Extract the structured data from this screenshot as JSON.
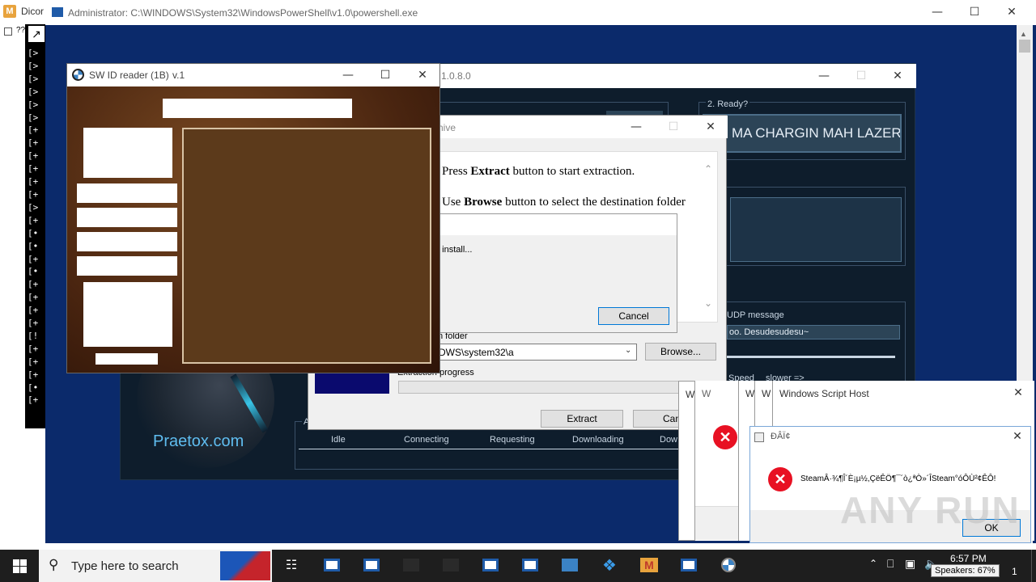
{
  "discord_win": {
    "title": "Dicor",
    "toolbar_text": "??"
  },
  "powershell": {
    "title": "Administrator: C:\\WINDOWS\\System32\\WindowsPowerShell\\v1.0\\powershell.exe",
    "lines": [
      "[>",
      "[>",
      "[>",
      "[>",
      "[>",
      "[>",
      "[+",
      "[+",
      "[+",
      "[+",
      "[+",
      "[+",
      "[>",
      "[+",
      "[•",
      "[•",
      "[+",
      "[•",
      "[+",
      "[+",
      "[+",
      "[+",
      "[!",
      "[+",
      "[+",
      "[+",
      "[•",
      "[+"
    ]
  },
  "loic": {
    "title": "1.0.8.0",
    "ready_label": "2. Ready?",
    "fire_button": "MA CHARGIN MAH LAZER",
    "udp_label": "UDP message",
    "udp_value": "oo. Desudesudesu~",
    "speed_label": "Speed",
    "speed_value": "slower =>",
    "site": "Praetox.com",
    "status_prefix": "A",
    "status_columns": [
      "Idle",
      "Connecting",
      "Requesting",
      "Downloading",
      "Dow"
    ]
  },
  "sw_reader": {
    "title": "SW ID reader (1B)",
    "version": "v.1"
  },
  "archive": {
    "title": "hive",
    "line1_pre": "Press ",
    "line1_bold": "Extract",
    "line1_post": " button to start extraction.",
    "line2_pre": "Use ",
    "line2_bold": "Browse",
    "line2_post": " button to select the destination folder",
    "folder_label": "n folder",
    "folder_value": "DWS\\system32\\a",
    "browse_button": "Browse...",
    "progress_label": "Extraction progress",
    "extract_button": "Extract",
    "cancel_button": "Canc"
  },
  "install_dialog": {
    "text": "o install...",
    "cancel_button": "Cancel"
  },
  "script_host": {
    "tab1": "Window",
    "tab2": "W",
    "tab3": "W",
    "tab4": "W",
    "title": "Windows Script Host"
  },
  "error_dialog": {
    "title": "ÐÂÏ¢",
    "message": "SteamÂ·¾¶Î´È¡µ½,ÇëÊÖ¶¯´ò¿ªÒ»´ÎSteam°óÔÙ²¢ÊÔ!",
    "ok_button": "OK"
  },
  "watermark": "ANY RUN",
  "taskbar": {
    "search_placeholder": "Type here to search",
    "time": "6:57 PM",
    "date": "1",
    "speakers": "Speakers: 67%"
  },
  "colors": {
    "desktop_blue": "#0b2a6b",
    "loic_dark": "#0e1d2c",
    "wood_brown": "#5c3a1b",
    "error_red": "#e81123",
    "taskbar": "#1e1e1e"
  }
}
